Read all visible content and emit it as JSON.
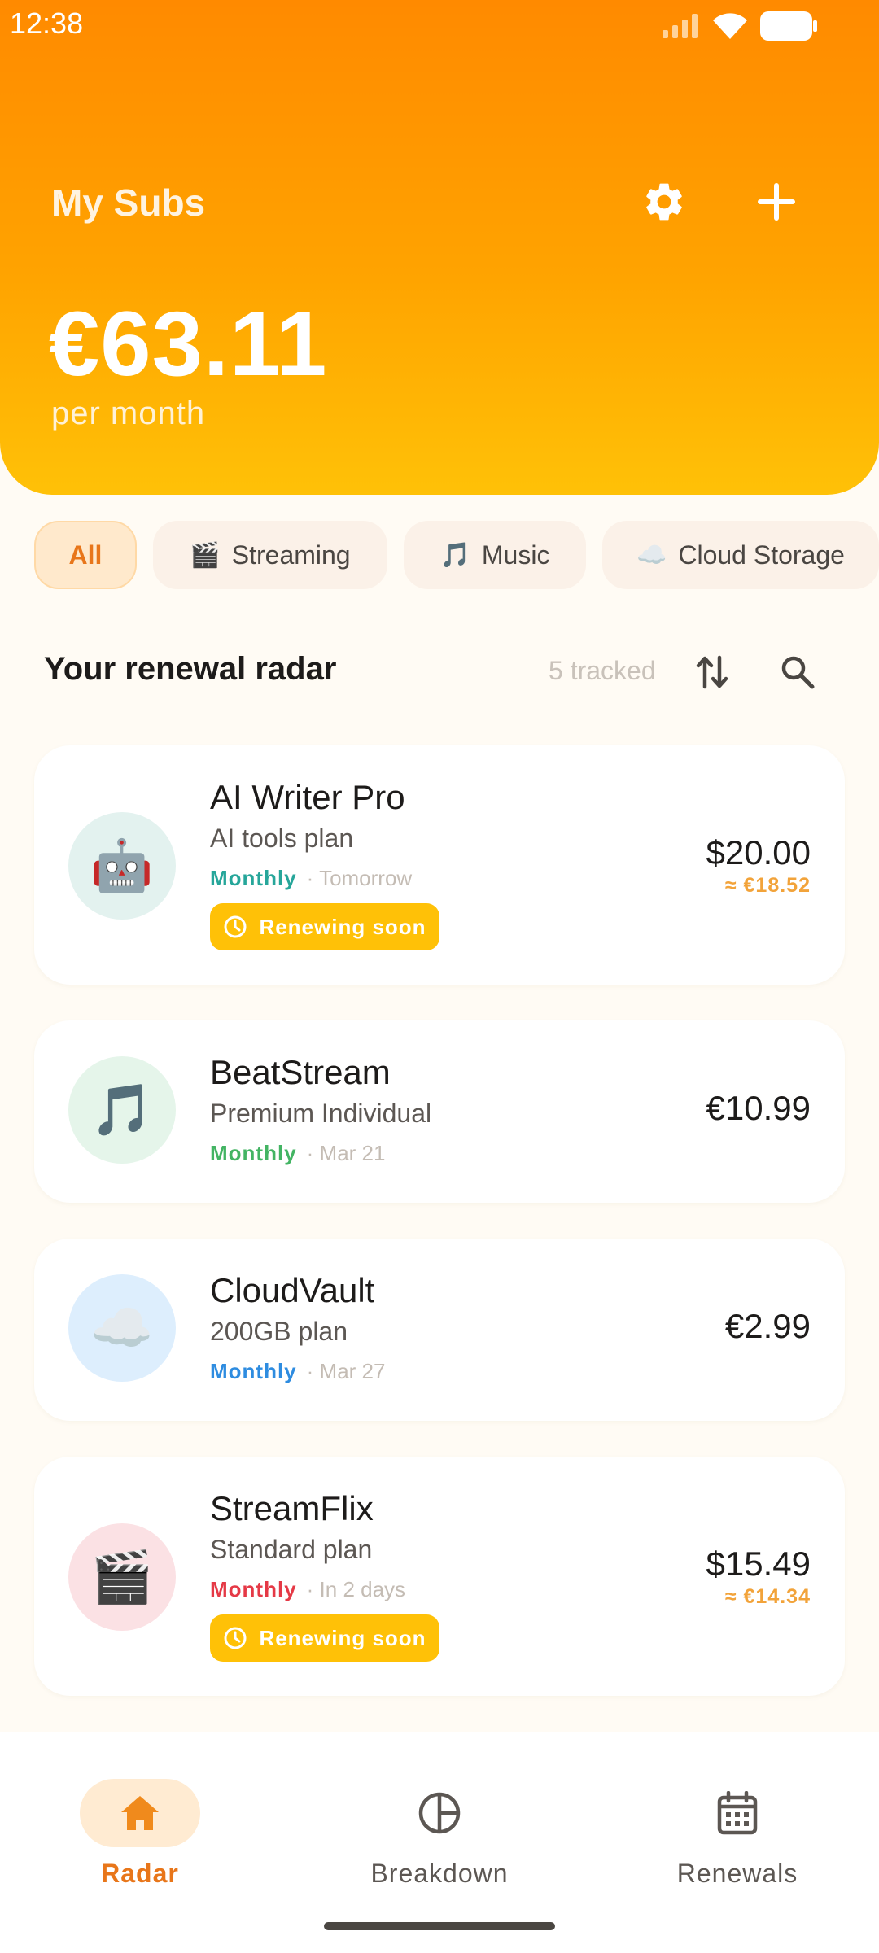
{
  "status_bar": {
    "time": "12:38"
  },
  "header": {
    "title": "My Subs",
    "total": "€63.11",
    "period": "per month"
  },
  "filters": [
    {
      "label": "All",
      "emoji": ""
    },
    {
      "label": "Streaming",
      "emoji": "🎬"
    },
    {
      "label": "Music",
      "emoji": "🎵"
    },
    {
      "label": "Cloud Storage",
      "emoji": "☁️"
    }
  ],
  "section": {
    "title": "Your renewal radar",
    "count": "5 tracked"
  },
  "subscriptions": [
    {
      "name": "AI Writer Pro",
      "plan": "AI tools plan",
      "cycle": "Monthly",
      "due": "· Tomorrow",
      "price": "$20.00",
      "converted": "≈ €18.52",
      "badge": "Renewing soon",
      "emoji": "🤖",
      "avatar_bg": "#E3F2EF",
      "cycle_color": "#26A69A"
    },
    {
      "name": "BeatStream",
      "plan": "Premium Individual",
      "cycle": "Monthly",
      "due": "· Mar 21",
      "price": "€10.99",
      "emoji": "🎵",
      "avatar_bg": "#E5F5EA",
      "cycle_color": "#43B463"
    },
    {
      "name": "CloudVault",
      "plan": "200GB plan",
      "cycle": "Monthly",
      "due": "· Mar 27",
      "price": "€2.99",
      "emoji": "☁️",
      "avatar_bg": "#DDEEFD",
      "cycle_color": "#2E8CE0"
    },
    {
      "name": "StreamFlix",
      "plan": "Standard plan",
      "cycle": "Monthly",
      "due": "· In 2 days",
      "price": "$15.49",
      "converted": "≈ €14.34",
      "badge": "Renewing soon",
      "emoji": "🎬",
      "avatar_bg": "#FBE1E4",
      "cycle_color": "#E53946"
    }
  ],
  "nav": [
    {
      "label": "Radar",
      "icon": "home-icon"
    },
    {
      "label": "Breakdown",
      "icon": "pie-chart-icon"
    },
    {
      "label": "Renewals",
      "icon": "calendar-icon"
    }
  ],
  "colors": {
    "accent": "#FF8A00",
    "badge": "#FFC107",
    "converted": "#F2A33A"
  }
}
